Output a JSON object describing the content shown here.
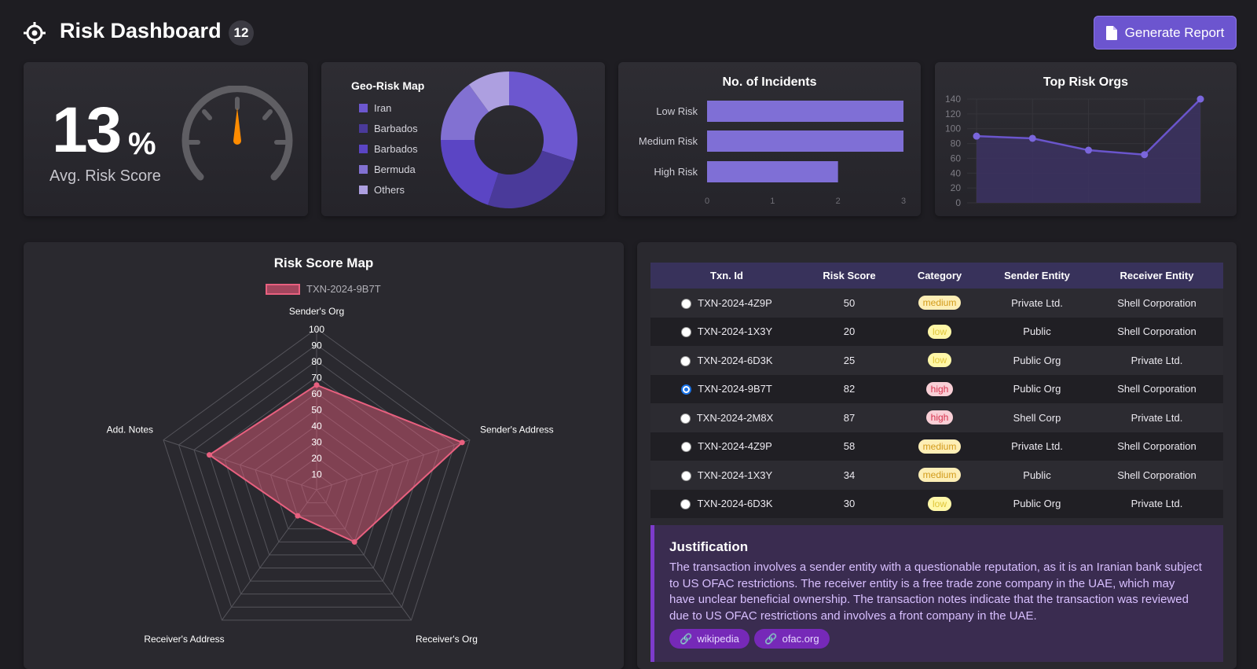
{
  "header": {
    "title": "Risk Dashboard",
    "badge": "12",
    "generate_button": "Generate Report"
  },
  "avg_risk": {
    "value": "13",
    "unit": "%",
    "label": "Avg. Risk Score",
    "gauge_level": 0.13
  },
  "geo_risk": {
    "title": "Geo-Risk Map",
    "legend": [
      "Iran",
      "Barbados",
      "Barbados",
      "Bermuda",
      "Others"
    ]
  },
  "incidents": {
    "title": "No. of Incidents"
  },
  "top_orgs": {
    "title": "Top Risk Orgs"
  },
  "radar": {
    "title": "Risk Score Map",
    "legend_label": "TXN-2024-9B7T"
  },
  "chart_data": [
    {
      "type": "pie",
      "title": "Geo-Risk Map",
      "labels": [
        "Iran",
        "Barbados",
        "Barbados",
        "Bermuda",
        "Others"
      ],
      "values": [
        30,
        25,
        20,
        15,
        10
      ],
      "colors": [
        "#6c57cf",
        "#4a3a9a",
        "#5b45c4",
        "#8271d2",
        "#ad9fe0"
      ]
    },
    {
      "type": "bar",
      "orientation": "horizontal",
      "title": "No. of Incidents",
      "categories": [
        "Low Risk",
        "Medium Risk",
        "High Risk"
      ],
      "values": [
        3,
        3,
        2
      ],
      "xlim": [
        0,
        3
      ],
      "xticks": [
        "0",
        "1",
        "2",
        "3"
      ],
      "color": "#7f6fd6"
    },
    {
      "type": "area",
      "title": "Top Risk Orgs",
      "values": [
        90,
        87,
        71,
        65,
        140
      ],
      "ylim": [
        0,
        140
      ],
      "yticks": [
        "0",
        "20",
        "40",
        "60",
        "80",
        "100",
        "120",
        "140"
      ],
      "color": "#6a55cc"
    },
    {
      "type": "radar",
      "title": "Risk Score Map",
      "axes": [
        "Sender's Org",
        "Sender's Address",
        "Receiver's Org",
        "Receiver's Address",
        "Add. Notes"
      ],
      "ticks": [
        "10",
        "20",
        "30",
        "40",
        "50",
        "60",
        "70",
        "80",
        "90",
        "100"
      ],
      "series": [
        {
          "name": "TXN-2024-9B7T",
          "values": [
            65,
            95,
            40,
            20,
            70
          ]
        }
      ],
      "color": "#e8607f"
    }
  ],
  "table": {
    "headers": [
      "Txn. Id",
      "Risk Score",
      "Category",
      "Sender Entity",
      "Receiver Entity"
    ],
    "rows": [
      {
        "id": "TXN-2024-4Z9P",
        "score": "50",
        "category": "medium",
        "sender": "Private Ltd.",
        "receiver": "Shell Corporation",
        "selected": false
      },
      {
        "id": "TXN-2024-1X3Y",
        "score": "20",
        "category": "low",
        "sender": "Public",
        "receiver": "Shell Corporation",
        "selected": false
      },
      {
        "id": "TXN-2024-6D3K",
        "score": "25",
        "category": "low",
        "sender": "Public Org",
        "receiver": "Private Ltd.",
        "selected": false
      },
      {
        "id": "TXN-2024-9B7T",
        "score": "82",
        "category": "high",
        "sender": "Public Org",
        "receiver": "Shell Corporation",
        "selected": true
      },
      {
        "id": "TXN-2024-2M8X",
        "score": "87",
        "category": "high",
        "sender": "Shell Corp",
        "receiver": "Private Ltd.",
        "selected": false
      },
      {
        "id": "TXN-2024-4Z9P",
        "score": "58",
        "category": "medium",
        "sender": "Private Ltd.",
        "receiver": "Shell Corporation",
        "selected": false
      },
      {
        "id": "TXN-2024-1X3Y",
        "score": "34",
        "category": "medium",
        "sender": "Public",
        "receiver": "Shell Corporation",
        "selected": false
      },
      {
        "id": "TXN-2024-6D3K",
        "score": "30",
        "category": "low",
        "sender": "Public Org",
        "receiver": "Private Ltd.",
        "selected": false
      }
    ]
  },
  "justification": {
    "title": "Justification",
    "text": "The transaction involves a sender entity with a questionable reputation, as it is an Iranian bank subject to US OFAC restrictions. The receiver entity is a free trade zone company in the UAE, which may have unclear beneficial ownership. The transaction notes indicate that the transaction was reviewed due to US OFAC restrictions and involves a front company in the UAE.",
    "links": [
      "wikipedia",
      "ofac.org"
    ]
  }
}
